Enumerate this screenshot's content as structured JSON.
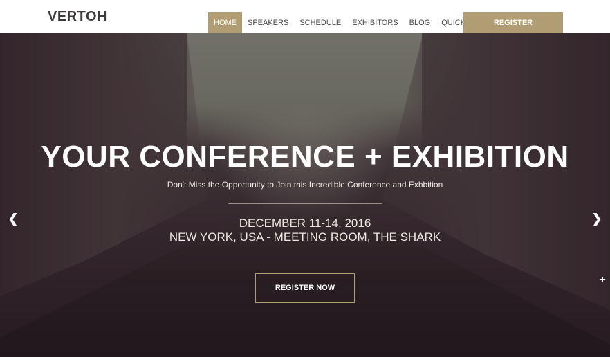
{
  "header": {
    "logo": "VERTOH",
    "nav": [
      {
        "label": "HOME",
        "active": true
      },
      {
        "label": "SPEAKERS"
      },
      {
        "label": "SCHEDULE"
      },
      {
        "label": "EXHIBITORS"
      },
      {
        "label": "BLOG"
      },
      {
        "label": "QUICK NAV"
      }
    ],
    "register_label": "REGISTER"
  },
  "hero": {
    "title": "YOUR CONFERENCE + EXHIBITION",
    "subtitle": "Don't Miss the Opportunity to Join this Incredible Conference and Exhbition",
    "date": "DECEMBER 11-14, 2016",
    "location": "NEW YORK, USA - MEETING ROOM, THE SHARK",
    "cta_label": "REGISTER NOW",
    "prev_icon": "chevron-left-icon",
    "next_icon": "chevron-right-icon",
    "plus_icon": "plus-icon"
  },
  "colors": {
    "accent": "#b09d73",
    "header_bg": "#ffffff",
    "logo_text": "#3d3a3b"
  }
}
